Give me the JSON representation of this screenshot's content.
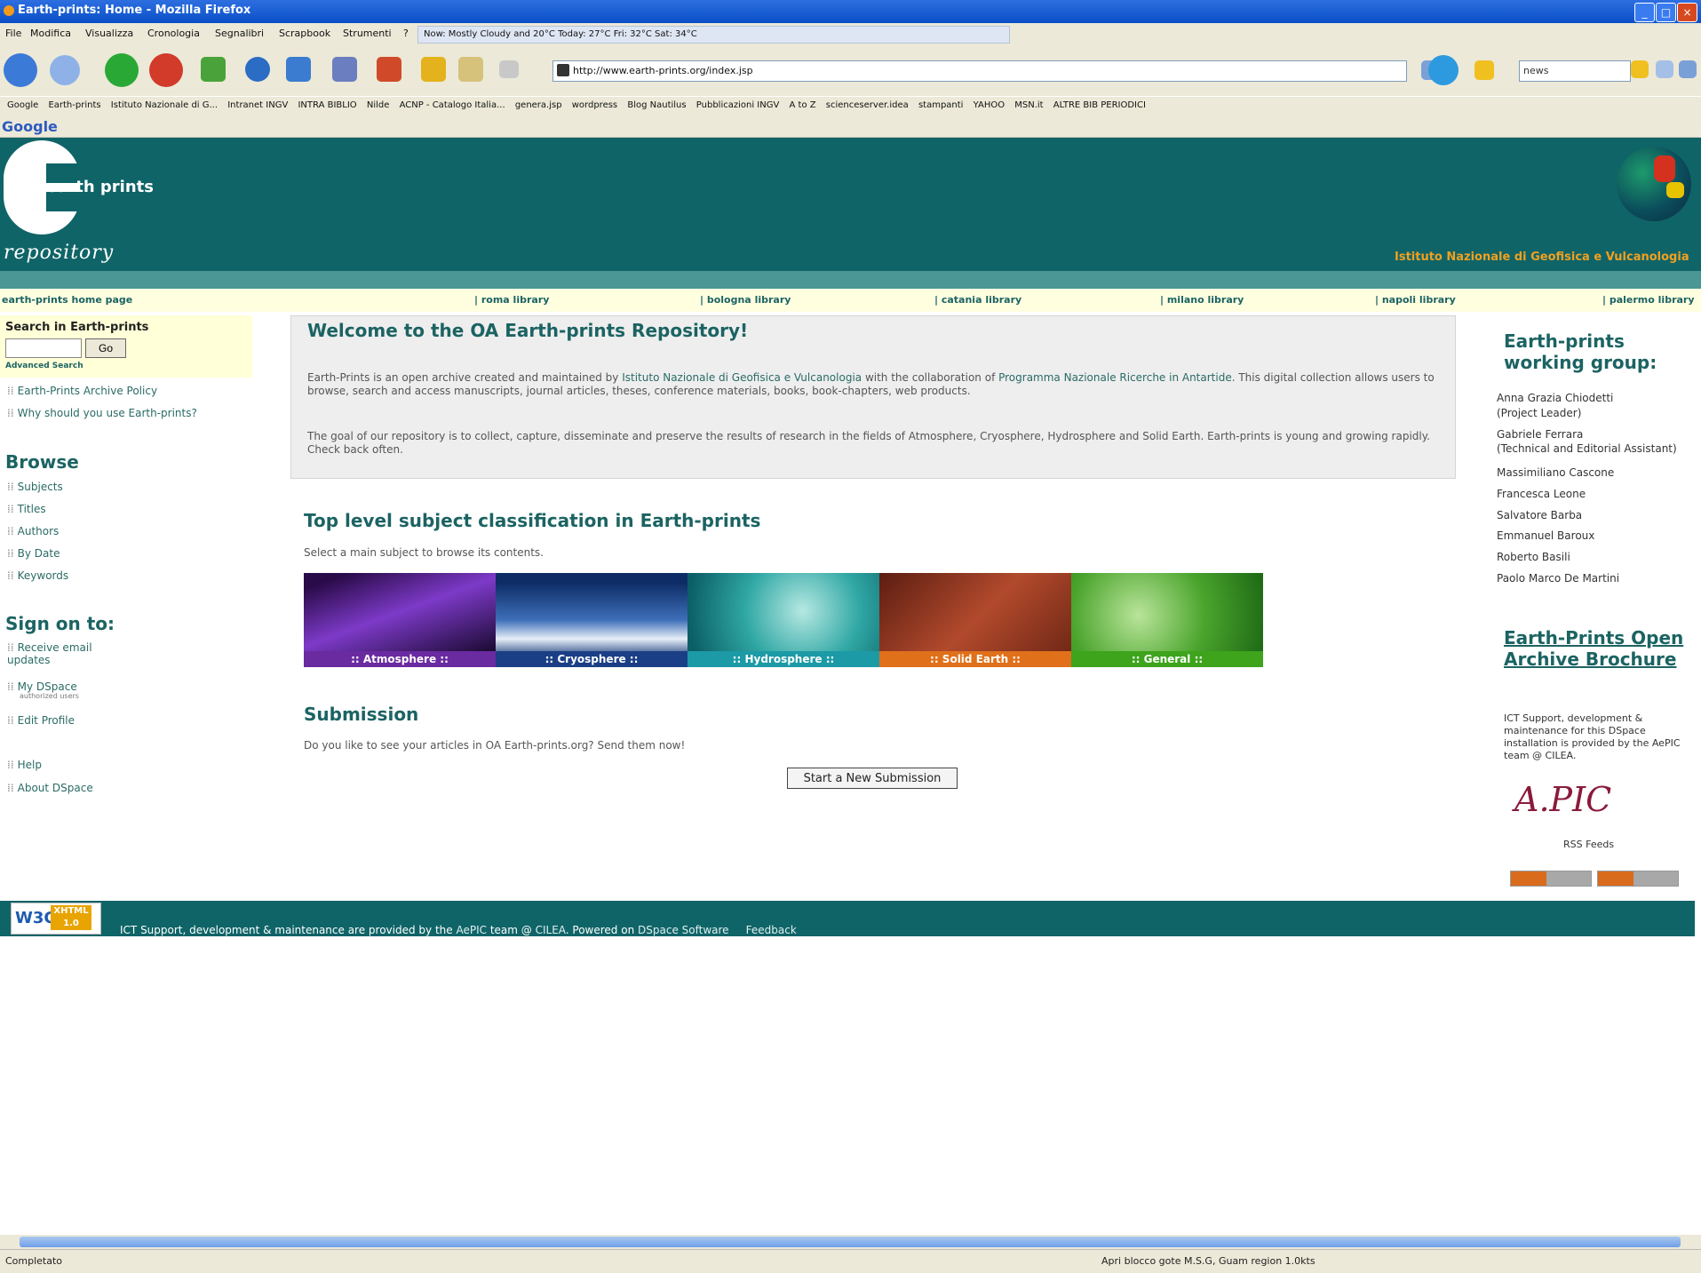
{
  "browser": {
    "window_title": "Earth-prints: Home - Mozilla Firefox",
    "menu": [
      "File",
      "Modifica",
      "Visualizza",
      "Cronologia",
      "Segnalibri",
      "Scrapbook",
      "Strumenti",
      "?"
    ],
    "weather": "Now: Mostly Cloudy and 20°C   Today: 27°C   Fri: 32°C   Sat: 34°C",
    "url": "http://www.earth-prints.org/index.jsp",
    "search_value": "news",
    "bookmarks": [
      "Google",
      "Earth-prints",
      "Istituto Nazionale di G...",
      "Intranet INGV",
      "INTRA BIBLIO",
      "Nilde",
      "ACNP - Catalogo Italia...",
      "genera.jsp",
      "wordpress",
      "Blog Nautilus",
      "Pubblicazioni INGV",
      "A to Z",
      "scienceserver.idea",
      "stampanti",
      "YAHOO",
      "MSN.it",
      "ALTRE BIB PERIODICI"
    ],
    "google_label": "Google",
    "status_left": "Completato",
    "status_right": "Apri blocco gote   M.S.G, Guam region   1.0kts"
  },
  "site": {
    "logo_text": "earth prints",
    "logo_sub": "repository",
    "institute": "Istituto Nazionale di Geofisica e Vulcanologia",
    "libraries": [
      {
        "label": "earth-prints home page"
      },
      {
        "label": "| roma library"
      },
      {
        "label": "| bologna library"
      },
      {
        "label": "| catania library"
      },
      {
        "label": "| milano library"
      },
      {
        "label": "| napoli library"
      },
      {
        "label": "| palermo library"
      }
    ]
  },
  "left": {
    "search_title": "Search in Earth-prints",
    "go_label": "Go",
    "advanced": "Advanced Search",
    "policy": "Earth-Prints Archive Policy",
    "why": "Why should you use Earth-prints?",
    "browse_title": "Browse",
    "browse": [
      "Subjects",
      "Titles",
      "Authors",
      "By Date",
      "Keywords"
    ],
    "sign_title": "Sign on to:",
    "receive": "Receive email updates",
    "mydspace": "My DSpace",
    "mydspace_note": "authorized users",
    "edit_profile": "Edit Profile",
    "help": "Help",
    "about": "About DSpace"
  },
  "main": {
    "welcome_title": "Welcome to the OA Earth-prints Repository!",
    "welcome_p1_a": "Earth-Prints is an open archive created and maintained by ",
    "welcome_p1_link1": "Istituto Nazionale di Geofisica e Vulcanologia",
    "welcome_p1_b": " with the collaboration of ",
    "welcome_p1_link2": "Programma Nazionale Ricerche in Antartide",
    "welcome_p1_c": ". This digital collection allows users to browse, search and access manuscripts, journal articles, theses, conference materials, books, book-chapters, web products.",
    "welcome_p2": "The goal of our repository is to collect, capture, disseminate and preserve the results of research in the fields of Atmosphere, Cryosphere, Hydrosphere and Solid Earth. Earth-prints is young and growing rapidly. Check back often.",
    "subject_title": "Top level subject classification in Earth-prints",
    "subject_hint": "Select a main subject to browse its contents.",
    "subjects": [
      {
        "label": ":: Atmosphere ::",
        "color": "#6a2aa0"
      },
      {
        "label": ":: Cryosphere ::",
        "color": "#1a3f86"
      },
      {
        "label": ":: Hydrosphere ::",
        "color": "#1c9aa6"
      },
      {
        "label": ":: Solid Earth ::",
        "color": "#e0701a"
      },
      {
        "label": ":: General ::",
        "color": "#3da41c"
      }
    ],
    "submission_title": "Submission",
    "submission_text": "Do you like to see your articles in OA Earth-prints.org? Send them now!",
    "submission_button": "Start a New Submission"
  },
  "right": {
    "group_title": "Earth-prints working group:",
    "members": [
      "Anna Grazia Chiodetti",
      "(Project Leader)",
      "Gabriele Ferrara",
      "(Technical and Editorial Assistant)",
      "Massimiliano Cascone",
      "Francesca Leone",
      "Salvatore Barba",
      "Emmanuel Baroux",
      "Roberto Basili",
      "Paolo Marco De Martini"
    ],
    "brochure": "Earth-Prints Open Archive Brochure",
    "ict_text": "ICT Support, development & maintenance for this DSpace installation is provided by the AePIC team @ CILEA.",
    "apic": "A.PIC",
    "rss": "RSS Feeds"
  },
  "footer": {
    "w3c": "W3C",
    "xhtml": "XHTML 1.0",
    "text_a": "ICT Support, development & maintenance are provided by the ",
    "aepic": "AePIC",
    "text_b": " team @ ",
    "cilea": "CILEA",
    "text_c": ". Powered on ",
    "dspace": "DSpace Software",
    "feedback": "Feedback"
  }
}
